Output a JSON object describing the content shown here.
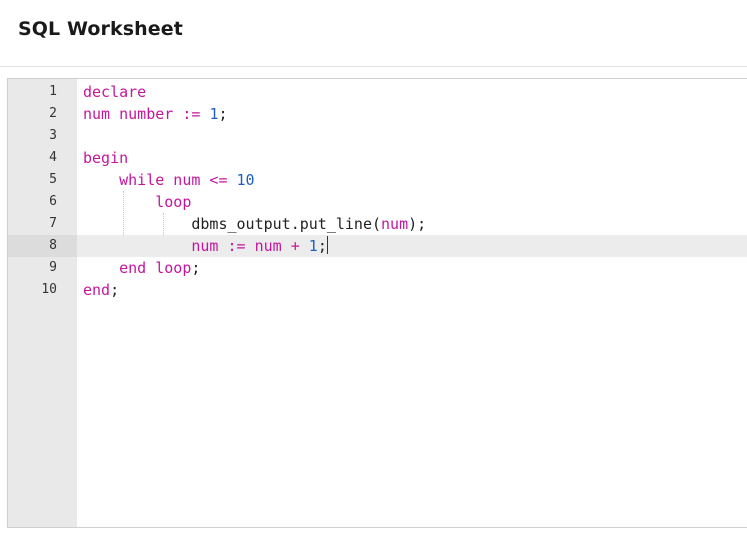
{
  "header": {
    "title": "SQL Worksheet"
  },
  "editor": {
    "active_line": 8,
    "lines": [
      {
        "number": "1",
        "tokens": [
          {
            "t": "declare",
            "c": "kw"
          }
        ]
      },
      {
        "number": "2",
        "tokens": [
          {
            "t": "num number := ",
            "c": "kw"
          },
          {
            "t": "1",
            "c": "num"
          },
          {
            "t": ";",
            "c": "plain"
          }
        ]
      },
      {
        "number": "3",
        "tokens": []
      },
      {
        "number": "4",
        "tokens": [
          {
            "t": "begin",
            "c": "kw"
          }
        ]
      },
      {
        "number": "5",
        "tokens": [
          {
            "t": "    while num <= ",
            "c": "kw"
          },
          {
            "t": "10",
            "c": "num"
          }
        ]
      },
      {
        "number": "6",
        "tokens": [
          {
            "t": "        loop",
            "c": "kw"
          }
        ]
      },
      {
        "number": "7",
        "tokens": [
          {
            "t": "            dbms_output.put_line(",
            "c": "plain"
          },
          {
            "t": "num",
            "c": "kw"
          },
          {
            "t": ");",
            "c": "plain"
          }
        ]
      },
      {
        "number": "8",
        "tokens": [
          {
            "t": "            num := num + ",
            "c": "kw"
          },
          {
            "t": "1",
            "c": "num"
          },
          {
            "t": ";",
            "c": "plain"
          }
        ]
      },
      {
        "number": "9",
        "tokens": [
          {
            "t": "    end loop",
            "c": "kw"
          },
          {
            "t": ";",
            "c": "plain"
          }
        ]
      },
      {
        "number": "10",
        "tokens": [
          {
            "t": "end",
            "c": "kw"
          },
          {
            "t": ";",
            "c": "plain"
          }
        ]
      }
    ]
  },
  "colors": {
    "keyword": "#c4169d",
    "number": "#1d5fc4",
    "text": "#222222",
    "gutter": "#e9e9e9",
    "active_line": "#ececec"
  }
}
